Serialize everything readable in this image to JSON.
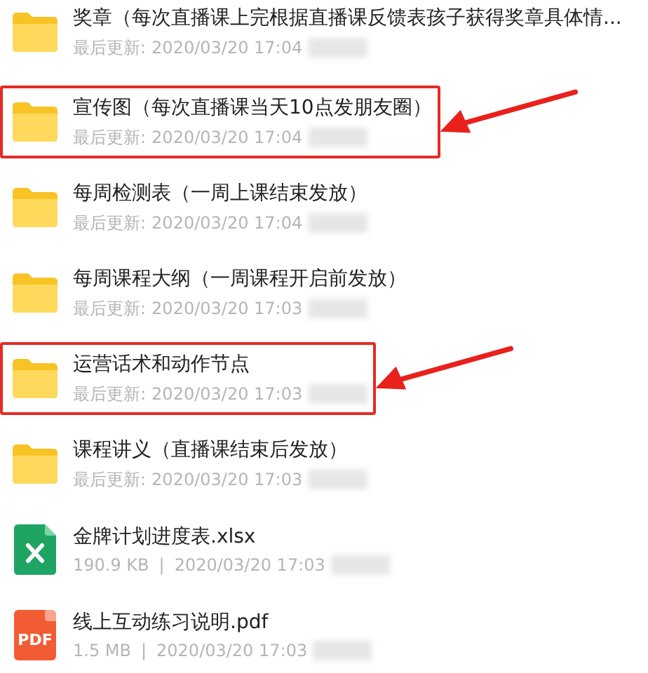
{
  "files": [
    {
      "kind": "folder",
      "name": "奖章（每次直播课上完根据直播课反馈表孩子获得奖章具体情...",
      "updated_label": "最后更新:",
      "updated": "2020/03/20 17:04",
      "highlighted": false
    },
    {
      "kind": "folder",
      "name": "宣传图（每次直播课当天10点发朋友圈）",
      "updated_label": "最后更新:",
      "updated": "2020/03/20 17:04",
      "highlighted": true
    },
    {
      "kind": "folder",
      "name": "每周检测表（一周上课结束发放）",
      "updated_label": "最后更新:",
      "updated": "2020/03/20 17:04",
      "highlighted": false
    },
    {
      "kind": "folder",
      "name": "每周课程大纲（一周课程开启前发放）",
      "updated_label": "最后更新:",
      "updated": "2020/03/20 17:03",
      "highlighted": false
    },
    {
      "kind": "folder",
      "name": "运营话术和动作节点",
      "updated_label": "最后更新:",
      "updated": "2020/03/20 17:03",
      "highlighted": true
    },
    {
      "kind": "folder",
      "name": "课程讲义（直播课结束后发放）",
      "updated_label": "最后更新:",
      "updated": "2020/03/20 17:03",
      "highlighted": false
    },
    {
      "kind": "xlsx",
      "name": "金牌计划进度表.xlsx",
      "size": "190.9 KB",
      "separator": "|",
      "updated": "2020/03/20 17:03",
      "highlighted": false
    },
    {
      "kind": "pdf",
      "name": "线上互动练习说明.pdf",
      "icon_text": "PDF",
      "size": "1.5 MB",
      "separator": "|",
      "updated": "2020/03/20 17:03",
      "highlighted": false
    }
  ]
}
